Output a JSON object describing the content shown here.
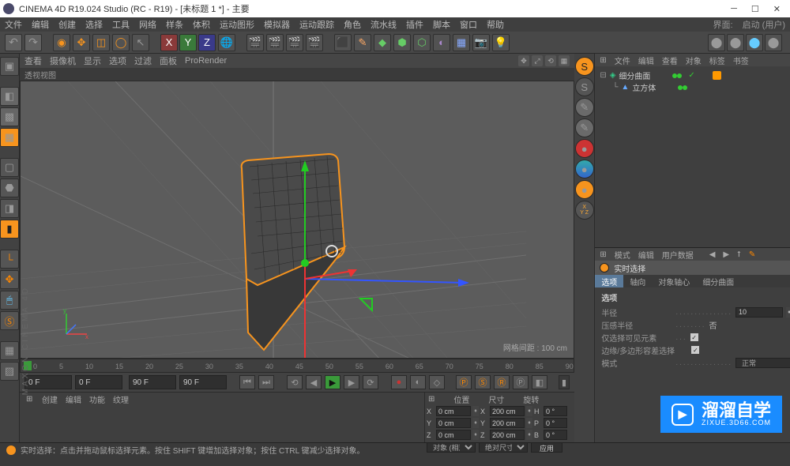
{
  "window": {
    "title": "CINEMA 4D R19.024 Studio (RC - R19) - [未标题 1 *] - 主要"
  },
  "menu": {
    "items": [
      "文件",
      "编辑",
      "创建",
      "选择",
      "工具",
      "网络",
      "样条",
      "体积",
      "运动图形",
      "模拟器",
      "运动跟踪",
      "角色",
      "流水线",
      "插件",
      "脚本",
      "窗口",
      "帮助"
    ],
    "layout_label": "界面:",
    "layout_value": "启动 (用户)"
  },
  "vp": {
    "tabs": [
      "查看",
      "摄像机",
      "显示",
      "选项",
      "过滤",
      "面板",
      "ProRender"
    ],
    "title": "透视视图",
    "grid_info": "网格间距 : 100 cm"
  },
  "timeline": {
    "ticks": [
      "0",
      "5",
      "10",
      "15",
      "20",
      "25",
      "30",
      "35",
      "40",
      "45",
      "50",
      "55",
      "60",
      "65",
      "70",
      "75",
      "80",
      "85",
      "90"
    ],
    "start": "0 F",
    "cur": "0 F",
    "end1": "90 F",
    "end2": "90 F"
  },
  "materials": {
    "tabs": [
      "创建",
      "编辑",
      "功能",
      "纹理"
    ]
  },
  "coord": {
    "headers": [
      "位置",
      "尺寸",
      "旋转"
    ],
    "rows": [
      {
        "axis": "X",
        "pos": "0 cm",
        "size": "200 cm",
        "rotl": "H",
        "rot": "0 °"
      },
      {
        "axis": "Y",
        "pos": "0 cm",
        "size": "200 cm",
        "rotl": "P",
        "rot": "0 °"
      },
      {
        "axis": "Z",
        "pos": "0 cm",
        "size": "200 cm",
        "rotl": "B",
        "rot": "0 °"
      }
    ],
    "btn1": "对象 (相对)",
    "btn2": "绝对尺寸",
    "btn3": "应用"
  },
  "objects": {
    "tabs": [
      "文件",
      "编辑",
      "查看",
      "对象",
      "标签",
      "书签"
    ],
    "tree": [
      {
        "indent": 0,
        "icon": "◆",
        "name": "细分曲面",
        "color": "#3aa"
      },
      {
        "indent": 1,
        "icon": "▲",
        "name": "立方体",
        "color": "#3aa"
      }
    ]
  },
  "attr": {
    "tabs": [
      "模式",
      "编辑",
      "用户数据"
    ],
    "title": "实时选择",
    "subtabs": [
      "选项",
      "轴向",
      "对象轴心",
      "细分曲面"
    ],
    "section": "选项",
    "rows": [
      {
        "label": "半径",
        "type": "num",
        "value": "10"
      },
      {
        "label": "压感半径",
        "type": "text",
        "value": "否"
      },
      {
        "label": "仅选择可见元素",
        "type": "chk",
        "value": true
      },
      {
        "label": "边缘/多边形容差选择",
        "type": "chk",
        "value": true
      },
      {
        "label": "模式",
        "type": "sel",
        "value": "正常"
      }
    ]
  },
  "status": "实时选择：点击并拖动鼠标选择元素。按住 SHIFT 键增加选择对象；按住 CTRL 键减少选择对象。",
  "watermark": {
    "main": "溜溜自学",
    "sub": "ZIXUE.3D66.COM"
  }
}
